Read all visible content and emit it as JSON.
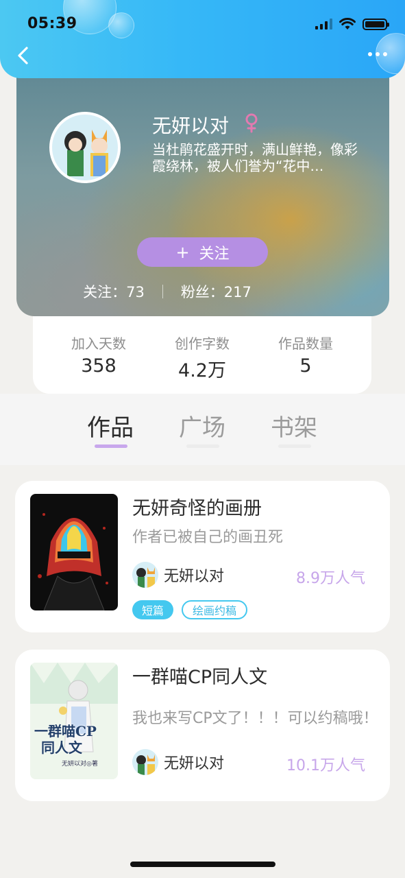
{
  "status_bar": {
    "time": "05:39"
  },
  "profile": {
    "name": "无妍以对",
    "bio": "当杜鹃花盛开时，满山鲜艳，像彩霞绕林，被人们誉为“花中…",
    "follow_plus": "+",
    "follow_label": "关注",
    "following_text": "关注：73",
    "fans_text": "粉丝：217",
    "accent_color": "#b58fe3"
  },
  "stats": [
    {
      "label": "加入天数",
      "value": "358"
    },
    {
      "label": "创作字数",
      "value": "4.2万"
    },
    {
      "label": "作品数量",
      "value": "5"
    }
  ],
  "tabs": [
    {
      "label": "作品",
      "active": true
    },
    {
      "label": "广场",
      "active": false
    },
    {
      "label": "书架",
      "active": false
    }
  ],
  "works": [
    {
      "title": "无妍奇怪的画册",
      "desc": "作者已被自己的画丑死",
      "author": "无妍以对",
      "popularity": "8.9万人气",
      "tags": [
        "短篇",
        "绘画约稿"
      ]
    },
    {
      "title": "一群喵CP同人文",
      "desc": "我也来写CP文了！！！可以约稿哦！",
      "author": "无妍以对",
      "popularity": "10.1万人气",
      "cover_title_line1": "一群喵CP",
      "cover_title_line2": "同人文",
      "cover_byline": "无妍以对◎著"
    }
  ]
}
